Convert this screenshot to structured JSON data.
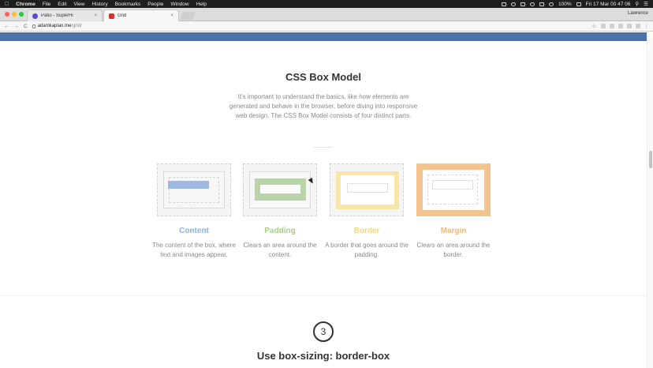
{
  "menubar": {
    "apple_icon": "apple-icon",
    "items": [
      "Chrome",
      "File",
      "Edit",
      "View",
      "History",
      "Bookmarks",
      "People",
      "Window",
      "Help"
    ],
    "battery": "100%",
    "clock": "Fri 17 Mar  00 47 06"
  },
  "browser": {
    "tabs": [
      {
        "title": "Patio - SuperHi",
        "close": "×"
      },
      {
        "title": "Grid",
        "close": "×"
      }
    ],
    "profile": "Lawrence",
    "url_host": "adamkaplan.me",
    "url_path": "/grid/",
    "nav": {
      "back": "←",
      "forward": "→",
      "reload": "C"
    },
    "toolbar_icons": {
      "star": "☆",
      "menu": "⋮"
    }
  },
  "page": {
    "section_title": "CSS Box Model",
    "intro": "It's important to understand the basics, like how elements are generated and behave in the browser, before diving into responsive web design. The CSS Box Model consists of four distinct parts.",
    "cards": [
      {
        "title": "Content",
        "desc": "The content of the box, where text and images appear.",
        "color": "#8fb1de"
      },
      {
        "title": "Padding",
        "desc": "Clears an area around the content.",
        "color": "#a7cc8c"
      },
      {
        "title": "Border",
        "desc": "A border that goes around the padding.",
        "color": "#f0d77c"
      },
      {
        "title": "Margin",
        "desc": "Clears an area around the border.",
        "color": "#f2b874"
      }
    ],
    "step_number": "3",
    "next_title": "Use box-sizing: border-box"
  }
}
